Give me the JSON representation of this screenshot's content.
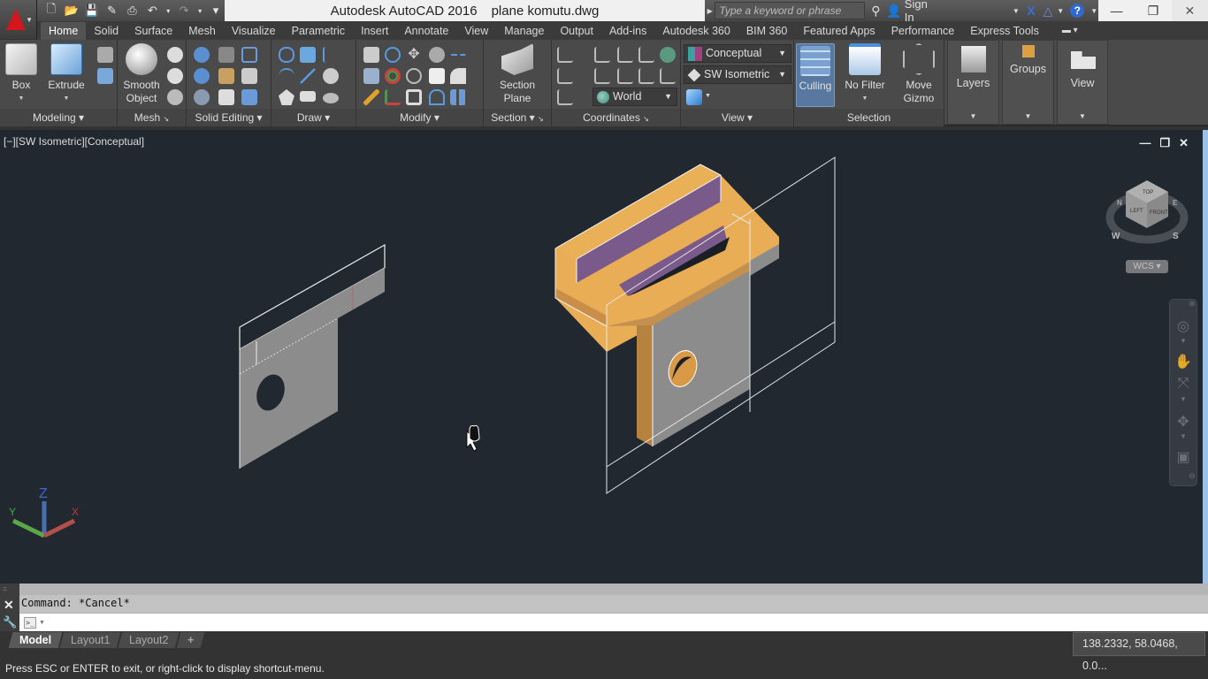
{
  "app": {
    "title": "Autodesk AutoCAD 2016",
    "document": "plane komutu.dwg",
    "logo": "autocad-a-logo"
  },
  "quick_access": [
    {
      "name": "new-icon",
      "glyph": "🗋"
    },
    {
      "name": "open-icon",
      "glyph": "📂"
    },
    {
      "name": "save-icon",
      "glyph": "💾"
    },
    {
      "name": "save-as-icon",
      "glyph": "✎"
    },
    {
      "name": "plot-icon",
      "glyph": "⎙"
    },
    {
      "name": "undo-icon",
      "glyph": "↶"
    },
    {
      "name": "redo-icon",
      "glyph": "↷"
    },
    {
      "name": "customize-icon",
      "glyph": "▾"
    }
  ],
  "header": {
    "search_placeholder": "Type a keyword or phrase",
    "sign_in": "Sign In",
    "help_glyph": "?"
  },
  "ribbon_tabs": [
    "Home",
    "Solid",
    "Surface",
    "Mesh",
    "Visualize",
    "Parametric",
    "Insert",
    "Annotate",
    "View",
    "Manage",
    "Output",
    "Add-ins",
    "Autodesk 360",
    "BIM 360",
    "Featured Apps",
    "Performance",
    "Express Tools"
  ],
  "active_tab": "Home",
  "panels": {
    "modeling": {
      "title": "Modeling",
      "box": "Box",
      "extrude": "Extrude"
    },
    "mesh": {
      "title": "Mesh",
      "smooth_object_1": "Smooth",
      "smooth_object_2": "Object"
    },
    "solid_editing": {
      "title": "Solid Editing"
    },
    "draw": {
      "title": "Draw"
    },
    "modify": {
      "title": "Modify"
    },
    "section": {
      "title": "Section",
      "section_plane_1": "Section",
      "section_plane_2": "Plane"
    },
    "coordinates": {
      "title": "Coordinates",
      "ucs_combo": "World"
    },
    "view": {
      "title": "View",
      "visual_style": "Conceptual",
      "view_direction": "SW Isometric"
    },
    "selection": {
      "title": "Selection",
      "culling": "Culling",
      "no_filter": "No Filter",
      "move_gizmo_1": "Move",
      "move_gizmo_2": "Gizmo"
    },
    "layers": {
      "title": "Layers"
    },
    "groups": {
      "title": "Groups"
    },
    "view_panel": {
      "title": "View"
    }
  },
  "viewport": {
    "label": "[−][SW Isometric][Conceptual]",
    "viewcube": {
      "top": "TOP",
      "left": "LEFT",
      "front": "FRONT",
      "compass": [
        "N",
        "E",
        "S",
        "W"
      ]
    },
    "wcs": "WCS",
    "ucs_axes": {
      "x": "X",
      "y": "Y",
      "z": "Z"
    },
    "colors": {
      "background": "#212830",
      "solid_orange": "#e8a850",
      "solid_purple": "#7a5a8a",
      "solid_gray": "#8c8c8c",
      "edge": "#f0f0f0"
    }
  },
  "command": {
    "history": "Command: *Cancel*",
    "input_value": "",
    "prompt_icon": ">_"
  },
  "layout_tabs": [
    "Model",
    "Layout1",
    "Layout2",
    "+"
  ],
  "active_layout": "Model",
  "status": {
    "coordinates": "138.2332, 58.0468, 0.0...",
    "message": "Press ESC or ENTER to exit, or right-click to display shortcut-menu."
  }
}
